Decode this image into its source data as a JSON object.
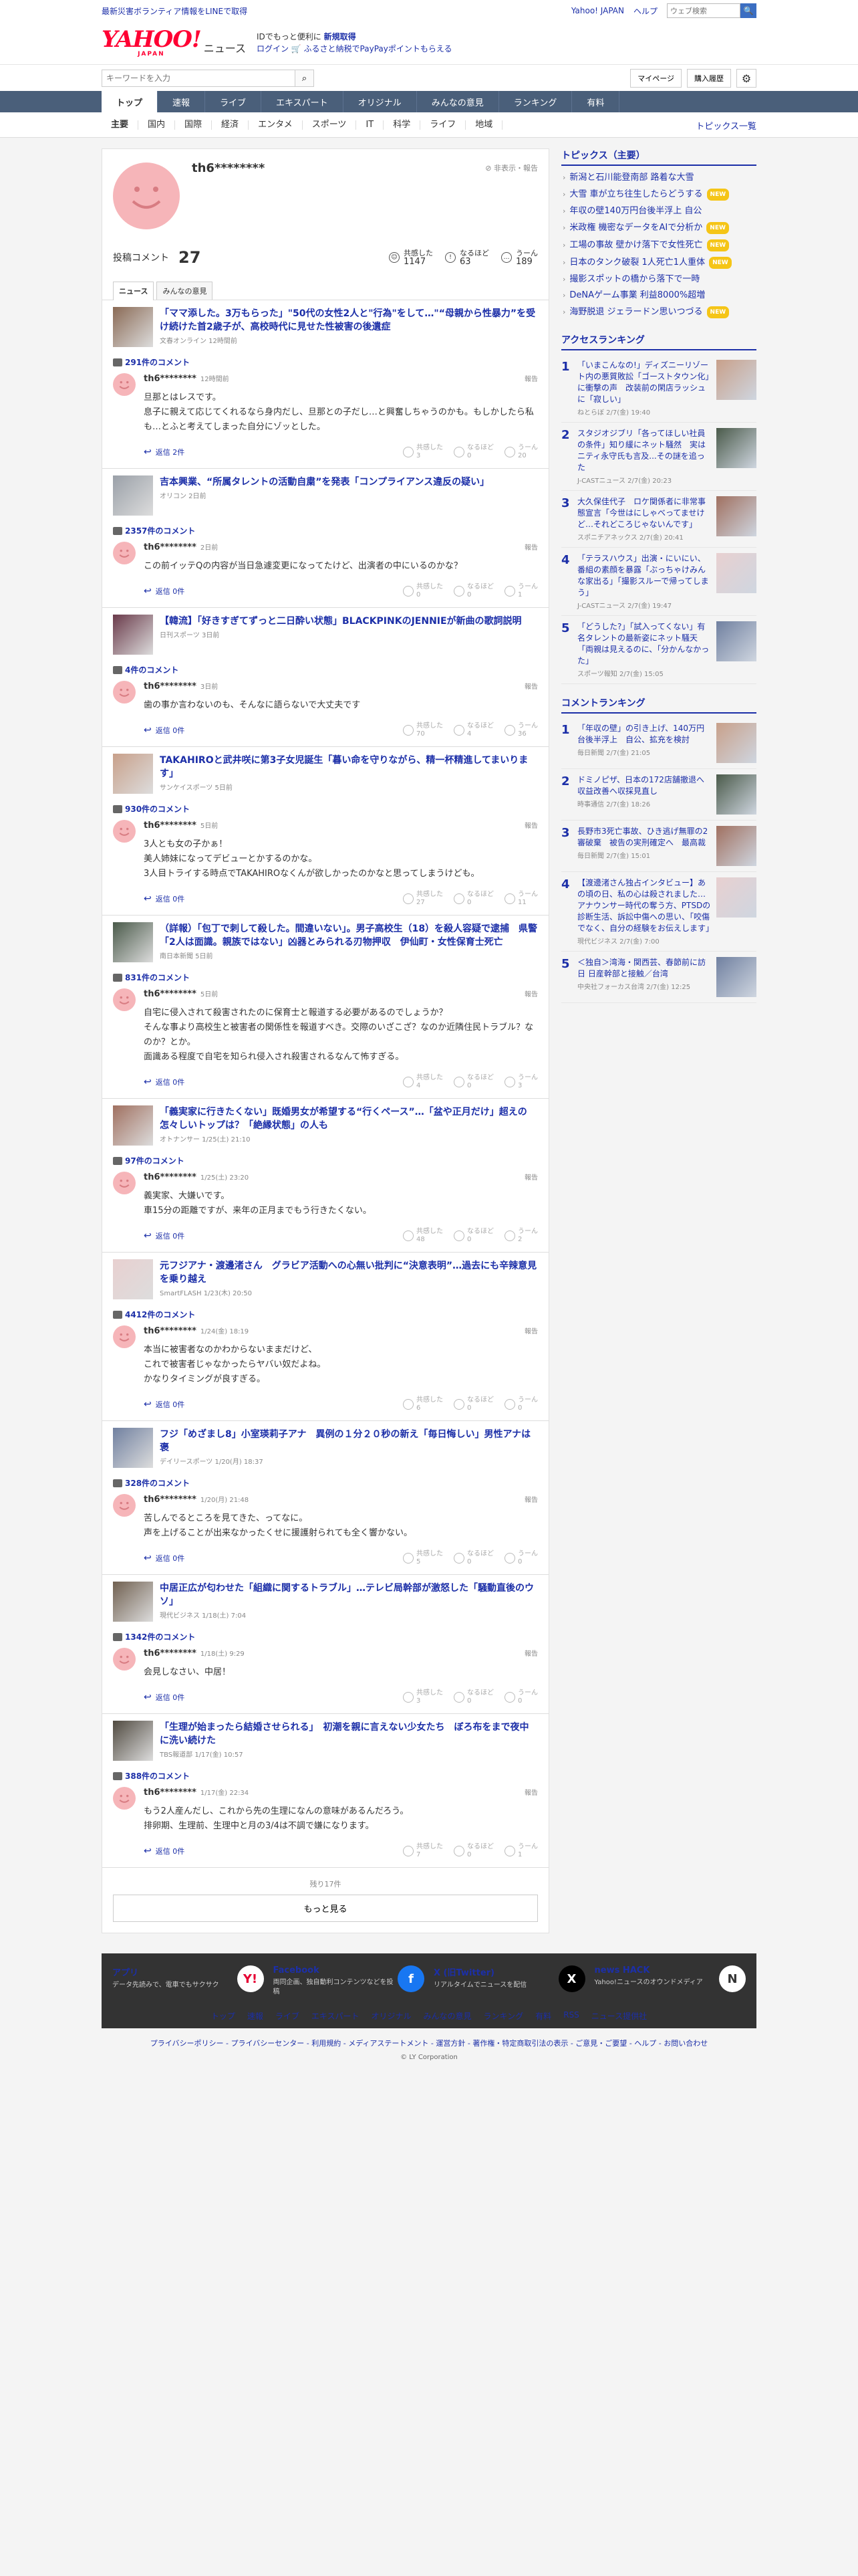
{
  "topbar": {
    "notice": "最新災害ボランティア情報をLINEで取得",
    "links": [
      "Yahoo! JAPAN",
      "ヘルプ"
    ],
    "search_placeholder": "ウェブ検索",
    "search_btn": "🔍"
  },
  "logobar": {
    "logo": "YAHOO!",
    "logo_sub": "JAPAN",
    "service": "ニュース",
    "promo_line1": "IDでもっと便利に",
    "promo_line1_link": "新規取得",
    "promo_line2": "ログイン 🛒 ふるさと納税でPayPayポイントもらえる"
  },
  "searchbar": {
    "placeholder": "キーワードを入力",
    "mypage": "マイページ",
    "history": "購入履歴"
  },
  "gnav": [
    "トップ",
    "速報",
    "ライブ",
    "エキスパート",
    "オリジナル",
    "みんなの意見",
    "ランキング",
    "有料"
  ],
  "subnav": [
    "主要",
    "国内",
    "国際",
    "経済",
    "エンタメ",
    "スポーツ",
    "IT",
    "科学",
    "ライフ",
    "地域"
  ],
  "subnav_last": "トピックス一覧",
  "profile": {
    "name": "th6********",
    "report": "非表示・報告",
    "comments_label": "投稿コメント",
    "comments_count": "27",
    "reactions": [
      {
        "label": "共感した",
        "value": "1147"
      },
      {
        "label": "なるほど",
        "value": "63"
      },
      {
        "label": "うーん",
        "value": "189"
      }
    ],
    "tabs": [
      "ニュース",
      "みんなの意見"
    ]
  },
  "entries": [
    {
      "title": "「ママ添した。3万もらった」\"50代の女性2人と\"行為\"をして…\"“母親から性暴力”を受け続けた首2歳子が、高校時代に見せた性被害の後遺症",
      "source": "文春オンライン 12時間前",
      "comment_count": "291件のコメント",
      "user": "th6********",
      "time": "12時間前",
      "text": "旦那とはレスです。\n息子に親えて応じてくれるなら身内だし、旦那との子だし…と興奮しちゃうのかも。もしかしたら私も…とふと考えてしまった自分にゾッとした。",
      "reply": "返信 2件",
      "counts": [
        "3",
        "0",
        "20"
      ]
    },
    {
      "title": "吉本興業、“所属タレントの活動自粛”を発表「コンプライアンス違反の疑い」",
      "source": "オリコン 2日前",
      "comment_count": "2357件のコメント",
      "user": "th6********",
      "time": "2日前",
      "text": "この前イッテQの内容が当日急遽変更になってたけど、出演者の中にいるのかな？",
      "reply": "返信 0件",
      "counts": [
        "0",
        "0",
        "1"
      ]
    },
    {
      "title": "【韓流】「好きすぎてずっと二日酔い状態」BLACKPINKのJENNIEが新曲の歌詞説明",
      "source": "日刊スポーツ 3日前",
      "comment_count": "4件のコメント",
      "user": "th6********",
      "time": "3日前",
      "text": "歯の事か言わないのも、そんなに語らないで大丈夫です",
      "reply": "返信 0件",
      "counts": [
        "70",
        "4",
        "36"
      ]
    },
    {
      "title": "TAKAHIROと武井咲に第3子女児誕生「暮い命を守りながら、精一杯精進してまいります」",
      "source": "サンケイスポーツ 5日前",
      "comment_count": "930件のコメント",
      "user": "th6********",
      "time": "5日前",
      "text": "3人とも女の子かぁ！\n美人姉妹になってデビューとかするのかな。\n3人目トライする時点でTAKAHIROなくんが欲しかったのかなと思ってしまうけども。",
      "reply": "返信 0件",
      "counts": [
        "27",
        "0",
        "11"
      ]
    },
    {
      "title": "（詳報）「包丁で刺して殺した。間違いない」。男子高校生（18）を殺人容疑で逮捕　県警「2人は面識。親族ではない」凶器とみられる刃物押収　伊仙町・女性保育士死亡",
      "source": "南日本新聞 5日前",
      "comment_count": "831件のコメント",
      "user": "th6********",
      "time": "5日前",
      "text": "自宅に侵入されて殺害されたのに保育士と報道する必要があるのでしょうか？\nそんな事より高校生と被害者の関係性を報道すべき。交際のいざこざ？なのか近隣住民トラブル？なのか？とか。\n面識ある程度で自宅を知られ侵入され殺害されるなんて怖すぎる。",
      "reply": "返信 0件",
      "counts": [
        "4",
        "0",
        "3"
      ]
    },
    {
      "title": "「義実家に行きたくない」既婚男女が希望する“行くペース”…「盆や正月だけ」超えの怎々しいトップは？「絶縁状態」の人も",
      "source": "オトナンサー 1/25(土) 21:10",
      "comment_count": "97件のコメント",
      "user": "th6********",
      "time": "1/25(土) 23:20",
      "text": "義実家、大嫌いです。\n車15分の距離ですが、来年の正月までもう行きたくない。",
      "reply": "返信 0件",
      "counts": [
        "48",
        "0",
        "2"
      ]
    },
    {
      "title": "元フジアナ・渡邊渚さん　グラビア活動への心無い批判に“決意表明”…過去にも辛辣意見を乗り越え",
      "source": "SmartFLASH 1/23(木) 20:50",
      "comment_count": "4412件のコメント",
      "user": "th6********",
      "time": "1/24(金) 18:19",
      "text": "本当に被害者なのかわからないままだけど、\nこれで被害者じゃなかったらヤバい奴だよね。\nかなりタイミングが良すぎる。",
      "reply": "返信 0件",
      "counts": [
        "6",
        "0",
        "0"
      ]
    },
    {
      "title": "フジ「めざまし8」小室瑛莉子アナ　異例の１分２０秒の新え「毎日悔しい」男性アナは褒",
      "source": "デイリースポーツ 1/20(月) 18:37",
      "comment_count": "328件のコメント",
      "user": "th6********",
      "time": "1/20(月) 21:48",
      "text": "苦しんでるところを見てきた、ってなに。\n声を上げることが出来なかったくせに援護射られても全く響かない。",
      "reply": "返信 0件",
      "counts": [
        "5",
        "0",
        "0"
      ]
    },
    {
      "title": "中居正広が匂わせた「組織に関するトラブル」…テレビ局幹部が激怒した「騒動直後のウソ」",
      "source": "現代ビジネス 1/18(土) 7:04",
      "comment_count": "1342件のコメント",
      "user": "th6********",
      "time": "1/18(土) 9:29",
      "text": "会見しなさい、中居！",
      "reply": "返信 0件",
      "counts": [
        "3",
        "0",
        "0"
      ]
    },
    {
      "title": "「生理が始まったら結婚させられる」　初潮を親に言えない少女たち　ぼろ布をまで夜中に洗い続けた",
      "source": "TBS報道部 1/17(金) 10:57",
      "comment_count": "388件のコメント",
      "user": "th6********",
      "time": "1/17(金) 22:34",
      "text": "もう2人産んだし、これから先の生理になんの意味があるんだろう。\n排卵期、生理前、生理中と月の3/4は不調で嫌になります。",
      "reply": "返信 0件",
      "counts": [
        "7",
        "0",
        "1"
      ]
    }
  ],
  "reaction_labels": [
    "共感した",
    "なるほど",
    "うーん"
  ],
  "more": {
    "remaining": "残り17件",
    "button": "もっと見る"
  },
  "side_topics": {
    "header": "トピックス（主要）",
    "new_badge": "NEW",
    "items": [
      {
        "text": "新潟と石川能登南部 路着な大雪",
        "badge": false
      },
      {
        "text": "大雪 車が立ち往生したらどうする",
        "badge": true
      },
      {
        "text": "年収の壁140万円台後半浮上 自公",
        "badge": false
      },
      {
        "text": "米政権 機密なデータをAIで分析か",
        "badge": true
      },
      {
        "text": "工場の事故 壁かけ落下で女性死亡",
        "badge": true
      },
      {
        "text": "日本のタンク破裂 1人死亡1人重体",
        "badge": true
      },
      {
        "text": "撮影スポットの橋から落下で一時",
        "badge": false
      },
      {
        "text": "DeNAゲーム事業 利益8000%超増",
        "badge": false
      },
      {
        "text": "海野脱退 ジェラードン思いつづる",
        "badge": true
      }
    ]
  },
  "access_ranking": {
    "header": "アクセスランキング",
    "items": [
      {
        "no": "1",
        "title": "「いまこんなの!」ディズニーリゾート内の悪質敗訟「ゴーストタウン化」に衝撃の声　改装前の閑店ラッシュに「寂しい」",
        "source": "ねとらぼ 2/7(金) 19:40"
      },
      {
        "no": "2",
        "title": "スタジオジブリ「各ってほしい社員の条件」知り緩にネット騒然　実はニティ永守氏も言及...その謎を追った",
        "source": "J-CASTニュース 2/7(金) 20:23"
      },
      {
        "no": "3",
        "title": "大久保佳代子　ロケ関係者に非常事態宣言「今世はにしゃべってませけど…それどころじゃないんです」",
        "source": "スポニチアネックス 2/7(金) 20:41"
      },
      {
        "no": "4",
        "title": "「テラスハウス」出演・にいにい、番組の素顔を暴露「ぶっちゃけみんな家出る」「撮影スルーで帰ってしまう」",
        "source": "J-CASTニュース 2/7(金) 19:47"
      },
      {
        "no": "5",
        "title": "「どうした?」「試入ってくない」有名タレントの最新姿にネット騒天「両親は見えるのに、「分かんなかった」",
        "source": "スポーツ報知 2/7(金) 15:05"
      }
    ]
  },
  "comment_ranking": {
    "header": "コメントランキング",
    "items": [
      {
        "no": "1",
        "title": "「年収の壁」の引き上げ、140万円台後半浮上　自公、拡充を検討",
        "source": "毎日新聞 2/7(金) 21:05"
      },
      {
        "no": "2",
        "title": "ドミノピザ、日本の172店舗撤退へ　収益改善へ収採見直し",
        "source": "時事通信 2/7(金) 18:26"
      },
      {
        "no": "3",
        "title": "長野市3死亡事故、ひき逃げ無罪の2審破棄　被告の実刑確定へ　最高裁",
        "source": "毎日新聞 2/7(金) 15:01"
      },
      {
        "no": "4",
        "title": "【渡邊渚さん独占インタビュー】あの頃の日、私の心は殺されました…アナウンサー時代の奪う方、PTSDの診断生活、訴訟中傷への思い、「咬傷でなく、自分の経験をお伝えします」",
        "source": "現代ビジネス 2/7(金) 7:00"
      },
      {
        "no": "5",
        "title": "＜独自＞湾海・関西芸、春節前に訪日 日産幹部と接触／台湾",
        "source": "中央社フォーカス台湾 2/7(金) 12:25"
      }
    ]
  },
  "footer": {
    "cols": [
      {
        "title": "アプリ",
        "desc": "データ先読みで、電車でもサクサク",
        "icon": "Y!"
      },
      {
        "title": "Facebook",
        "desc": "両同企画、独自動利コンテンツなどを投稿",
        "icon": "f"
      },
      {
        "title": "X (旧Twitter)",
        "desc": "リアルタイムでニュースを配信",
        "icon": "X"
      },
      {
        "title": "news HACK",
        "desc": "Yahoo!ニュースのオウンドメディア",
        "icon": "N"
      }
    ],
    "links": [
      "トップ",
      "速報",
      "ライブ",
      "エキスパート",
      "オリジナル",
      "みんなの意見",
      "ランキング",
      "有料",
      "RSS",
      "ニュース提供社"
    ],
    "legal": "プライバシーポリシー - プライバシーセンター - 利用規約 - メディアステートメント - 運営方針 - 著作権・特定商取引法の表示 - ご意見・ご要望 - ヘルプ - お問い合わせ",
    "copyright": "© LY Corporation"
  }
}
